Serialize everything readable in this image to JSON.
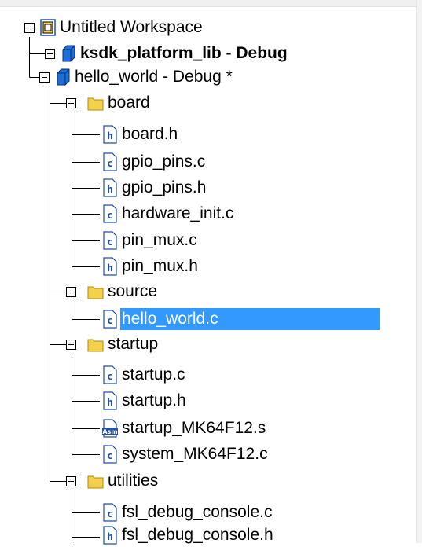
{
  "tree": {
    "workspace": {
      "label": "Untitled Workspace",
      "icon": "workspace-icon"
    },
    "projects": [
      {
        "label": "ksdk_platform_lib - Debug",
        "icon": "project-icon",
        "expanded": false,
        "bold": true
      },
      {
        "label": "hello_world - Debug *",
        "icon": "project-icon",
        "expanded": true,
        "bold": false
      }
    ],
    "folders": [
      {
        "label": "board",
        "icon": "folder-icon",
        "files": [
          {
            "label": "board.h",
            "icon": "header-file-icon"
          },
          {
            "label": "gpio_pins.c",
            "icon": "c-file-icon"
          },
          {
            "label": "gpio_pins.h",
            "icon": "header-file-icon"
          },
          {
            "label": "hardware_init.c",
            "icon": "c-file-icon"
          },
          {
            "label": "pin_mux.c",
            "icon": "c-file-icon"
          },
          {
            "label": "pin_mux.h",
            "icon": "header-file-icon"
          }
        ]
      },
      {
        "label": "source",
        "icon": "folder-icon",
        "files": [
          {
            "label": "hello_world.c",
            "icon": "c-file-icon",
            "selected": true
          }
        ]
      },
      {
        "label": "startup",
        "icon": "folder-icon",
        "files": [
          {
            "label": "startup.c",
            "icon": "c-file-icon"
          },
          {
            "label": "startup.h",
            "icon": "header-file-icon"
          },
          {
            "label": "startup_MK64F12.s",
            "icon": "asm-file-icon"
          },
          {
            "label": "system_MK64F12.c",
            "icon": "c-file-icon"
          }
        ]
      },
      {
        "label": "utilities",
        "icon": "folder-icon",
        "files": [
          {
            "label": "fsl_debug_console.c",
            "icon": "c-file-icon"
          },
          {
            "label": "fsl_debug_console.h",
            "icon": "header-file-icon"
          }
        ]
      }
    ]
  },
  "colors": {
    "selection": "#3399ff",
    "folder": "#f5d04a",
    "project": "#1e6fd9"
  }
}
